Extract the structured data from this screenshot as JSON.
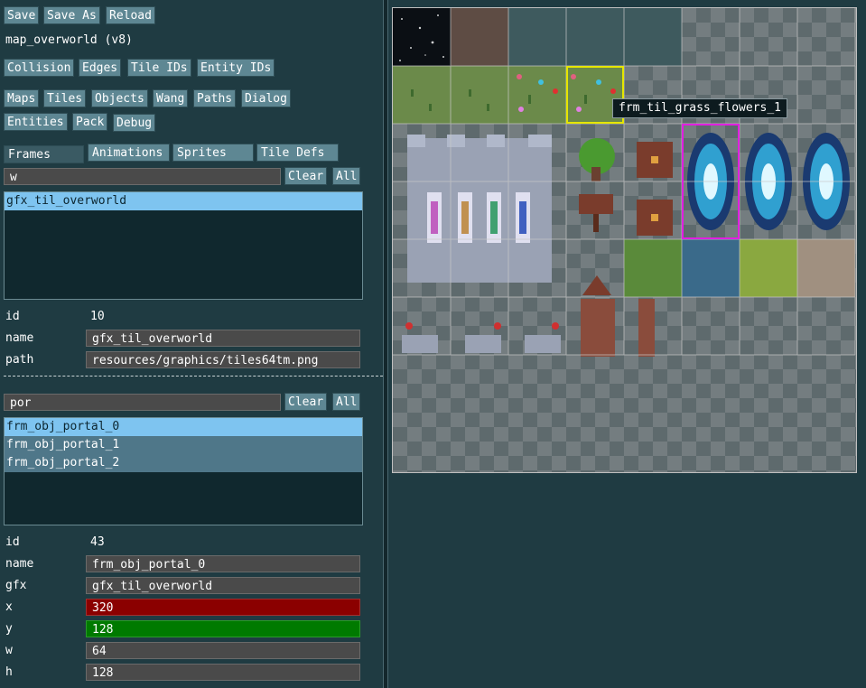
{
  "toolbar": {
    "save": "Save",
    "save_as": "Save As",
    "reload": "Reload"
  },
  "map_title": "map_overworld  (v8)",
  "view_toggles": {
    "collision": "Collision",
    "edges": "Edges",
    "tile_ids": "Tile IDs",
    "entity_ids": "Entity IDs"
  },
  "nav": {
    "maps": "Maps",
    "tiles": "Tiles",
    "objects": "Objects",
    "wang": "Wang",
    "paths": "Paths",
    "dialog": "Dialog",
    "entities": "Entities",
    "pack": "Pack",
    "debug": "Debug"
  },
  "subtabs": {
    "frames": "Frames",
    "animations": "Animations",
    "sprites": "Sprites",
    "tile_defs": "Tile Defs"
  },
  "gfx_filter": {
    "value": "w",
    "clear": "Clear",
    "all": "All",
    "items": [
      "gfx_til_overworld"
    ]
  },
  "gfx_props": {
    "id_label": "id",
    "id_value": "10",
    "name_label": "name",
    "name_value": "gfx_til_overworld",
    "path_label": "path",
    "path_value": "resources/graphics/tiles64tm.png"
  },
  "frame_filter": {
    "value": "por",
    "clear": "Clear",
    "all": "All",
    "items": [
      "frm_obj_portal_0",
      "frm_obj_portal_1",
      "frm_obj_portal_2"
    ]
  },
  "frame_props": {
    "id_label": "id",
    "id_value": "43",
    "name_label": "name",
    "name_value": "frm_obj_portal_0",
    "gfx_label": "gfx",
    "gfx_value": "gfx_til_overworld",
    "x_label": "x",
    "x_value": "320",
    "y_label": "y",
    "y_value": "128",
    "w_label": "w",
    "w_value": "64",
    "h_label": "h",
    "h_value": "128"
  },
  "tooltip": "frm_til_grass_flowers_1",
  "colors": {
    "panel_bg": "#1f3b42",
    "button": "#5e8793",
    "selected": "#7ec4f0",
    "x_field": "#8b0000",
    "y_field": "#007a00",
    "hover_tile": "#e6e600",
    "selected_frame": "#e020e0"
  }
}
